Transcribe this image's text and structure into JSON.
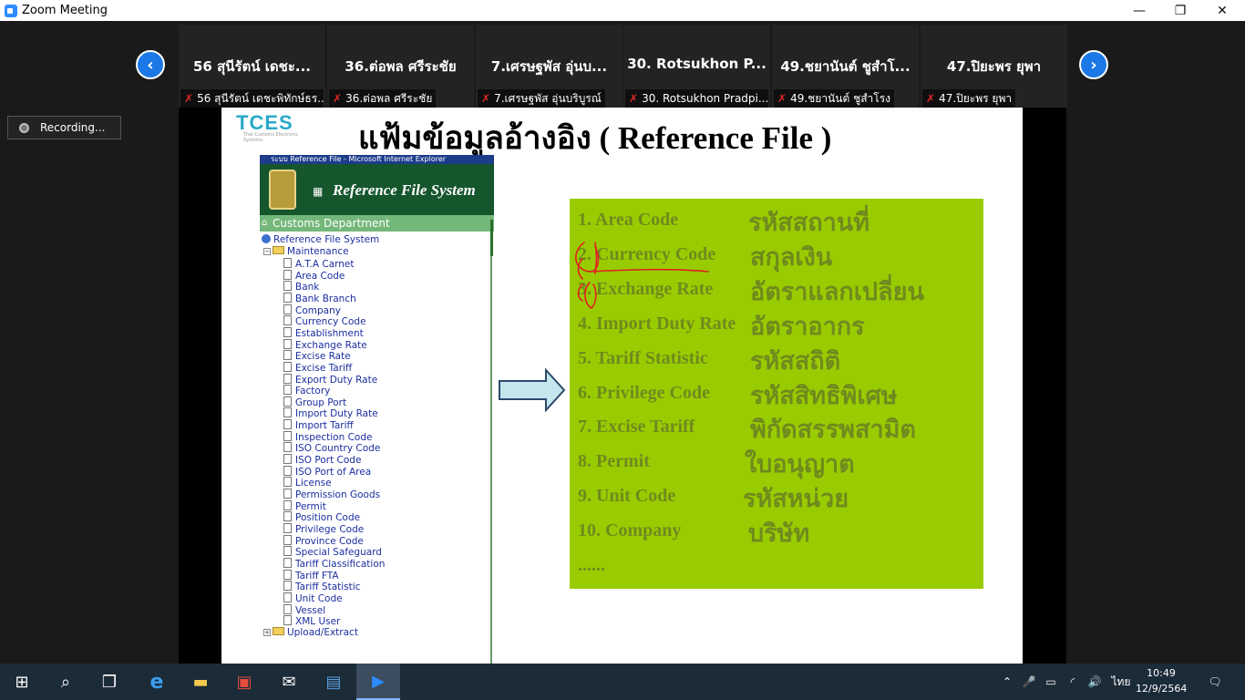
{
  "window": {
    "title": "Zoom Meeting",
    "icon": "zoom-app-icon",
    "minimize": "—",
    "restore": "❐",
    "close": "✕"
  },
  "gallery": {
    "prev": "‹",
    "next": "›",
    "participants": [
      {
        "name": "56 สุนีรัตน์ เดชะ...",
        "label": "56 สุนีรัตน์ เดชะพิทักษ์ธร..."
      },
      {
        "name": "36.ต่อพล ศรีระชัย",
        "label": "36.ต่อพล ศรีระชัย"
      },
      {
        "name": "7.เศรษฐพัส อุ่นบ...",
        "label": "7.เศรษฐพัส อุ่นบริบูรณ์"
      },
      {
        "name": "30. Rotsukhon P...",
        "label": "30. Rotsukhon Pradpi..."
      },
      {
        "name": "49.ชยานันต์ ชูสำโ...",
        "label": "49.ชยานันต์ ชูสำโรง"
      },
      {
        "name": "47.ปิยะพร ยุพา",
        "label": "47.ปิยะพร ยุพา"
      }
    ]
  },
  "recording": {
    "label": "Recording..."
  },
  "slide": {
    "logo": "TCES",
    "logo_sub": "Thai Customs Electronic Systems",
    "title": "แฟ้มข้อมูลอ้างอิง ( Reference File )",
    "ie_window_title": "ระบบ Reference File - Microsoft Internet Explorer",
    "ie_banner": "Reference File System",
    "ie_department": "Customs Department",
    "tree_root": "Reference File System",
    "tree_folder": "Maintenance",
    "tree_items": [
      "A.T.A Carnet",
      "Area Code",
      "Bank",
      "Bank Branch",
      "Company",
      "Currency Code",
      "Establishment",
      "Exchange Rate",
      "Excise Rate",
      "Excise Tariff",
      "Export Duty Rate",
      "Factory",
      "Group Port",
      "Import Duty Rate",
      "Import Tariff",
      "Inspection Code",
      "ISO Country Code",
      "ISO Port Code",
      "ISO Port of Area",
      "License",
      "Permission Goods",
      "Permit",
      "Position Code",
      "Privilege Code",
      "Province Code",
      "Special Safeguard",
      "Tariff Classification",
      "Tariff FTA",
      "Tariff Statistic",
      "Unit Code",
      "Vessel",
      "XML User"
    ],
    "tree_folder2": "Upload/Extract",
    "panel_items": [
      {
        "en": "1. Area Code",
        "th": "รหัสสถานที่"
      },
      {
        "en": "2. Currency Code",
        "th": "สกุลเงิน"
      },
      {
        "en": "3. Exchange Rate",
        "th": "อัตราแลกเปลี่ยน"
      },
      {
        "en": "4. Import Duty Rate",
        "th": "อัตราอากร"
      },
      {
        "en": "5. Tariff Statistic",
        "th": "รหัสสถิติ"
      },
      {
        "en": "6. Privilege Code",
        "th": "รหัสสิทธิพิเศษ"
      },
      {
        "en": "7. Excise Tariff",
        "th": "พิกัดสรรพสามิต"
      },
      {
        "en": "8. Permit",
        "th": "ใบอนุญาต"
      },
      {
        "en": "9. Unit Code",
        "th": "รหัสหน่วย"
      },
      {
        "en": "10. Company",
        "th": "บริษัท"
      }
    ],
    "panel_more": "......",
    "colors": {
      "panel": "#99cc00",
      "panel_text": "#6f8a1e",
      "annotation": "#e02020"
    }
  },
  "taskbar": {
    "start": "⊞",
    "search": "⌕",
    "taskview": "❐",
    "edge": "e",
    "explorer": "▬",
    "store": "▣",
    "mail": "✉",
    "app5": "▤",
    "zoom": "▶",
    "tray_up": "⌃",
    "tray_mic": "🎤",
    "tray_battery": "▭",
    "tray_wifi": "◜",
    "tray_volume": "🔊",
    "language": "ไทย",
    "time": "10:49",
    "date": "12/9/2564",
    "notifications": "🗨"
  }
}
